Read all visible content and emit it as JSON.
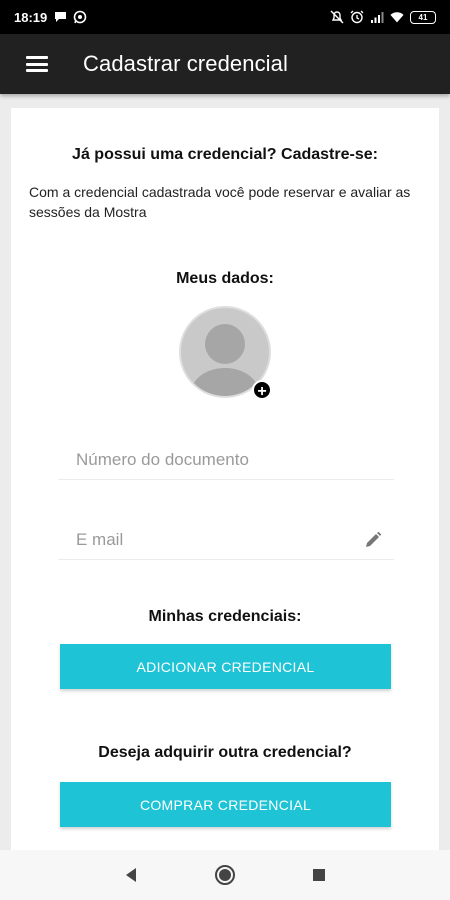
{
  "status": {
    "time": "18:19",
    "battery": "41",
    "left_icons": [
      "chat-bubble-icon",
      "whatsapp-icon"
    ],
    "right_icons": [
      "mute-icon",
      "alarm-icon",
      "signal-icon",
      "wifi-icon"
    ]
  },
  "appbar": {
    "title": "Cadastrar credencial",
    "menu_icon": "hamburger-menu-icon"
  },
  "card": {
    "heading": "Já possui uma credencial? Cadastre-se:",
    "description": "Com a credencial cadastrada você pode reservar e avaliar as sessões da Mostra",
    "my_data_label": "Meus dados:",
    "document_placeholder": "Número do documento",
    "email_placeholder": "E mail",
    "my_credentials_label": "Minhas credenciais:",
    "add_button": "ADICIONAR CREDENCIAL",
    "buy_question": "Deseja adquirir outra credencial?",
    "buy_button": "COMPRAR CREDENCIAL"
  },
  "colors": {
    "accent": "#1ec3d6",
    "appbar": "#212121",
    "statusbar": "#000000"
  },
  "navbar": {
    "icons": [
      "back-icon",
      "home-icon",
      "recents-icon"
    ]
  }
}
